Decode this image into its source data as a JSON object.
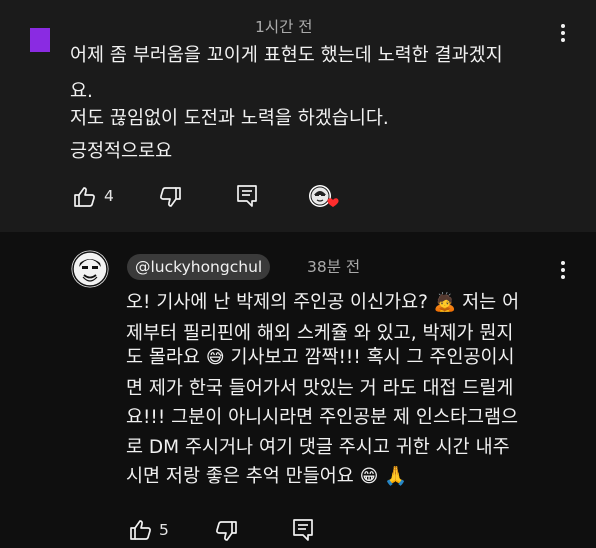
{
  "comment": {
    "time": "1시간 전",
    "lines": [
      "어제 좀 부러움을 꼬이게 표현도 했는데 노력한 결과겠지",
      "요.",
      "저도 끊임없이 도전과 노력을 하겠습니다.",
      "긍정적으로요"
    ],
    "like_count": "4"
  },
  "reply": {
    "handle": "@luckyhongchul",
    "time": "38분 전",
    "lines": [
      {
        "text": "오! 기사에 난 박제의 주인공 이신가요?",
        "emoji": "🙇",
        "after": " 저는 어"
      },
      {
        "text": "제부터 필리핀에 해외 스케쥴 와 있고, 박제가 뭔지",
        "emoji": "",
        "after": ""
      },
      {
        "text": "도 몰라요",
        "emoji": "😅",
        "after": " 기사보고 깜짝!!! 혹시 그 주인공이시"
      },
      {
        "text": "면 제가 한국 들어가서 맛있는 거 라도 대접 드릴게",
        "emoji": "",
        "after": ""
      },
      {
        "text": "요!!! 그분이 아니시라면 주인공분 제 인스타그램으",
        "emoji": "",
        "after": ""
      },
      {
        "text": "로 DM 주시거나 여기 댓글 주시고 귀한 시간 내주",
        "emoji": "",
        "after": ""
      },
      {
        "text": "시면 저랑 좋은 추억 만들어요",
        "emoji": "😁",
        "after": " 🙏"
      }
    ],
    "like_count": "5"
  },
  "icons": {
    "like": "thumbs-up-icon",
    "dislike": "thumbs-down-icon",
    "reply": "comment-reply-icon",
    "more": "more-vertical-icon",
    "heart": "creator-heart-icon"
  },
  "colors": {
    "background": "#181818",
    "reply_background": "#0f0f0f",
    "avatar_purple": "#8a2be2",
    "heart": "#ff2d2d",
    "handle_pill": "#3a3a3a",
    "secondary_text": "#aaaaaa"
  }
}
